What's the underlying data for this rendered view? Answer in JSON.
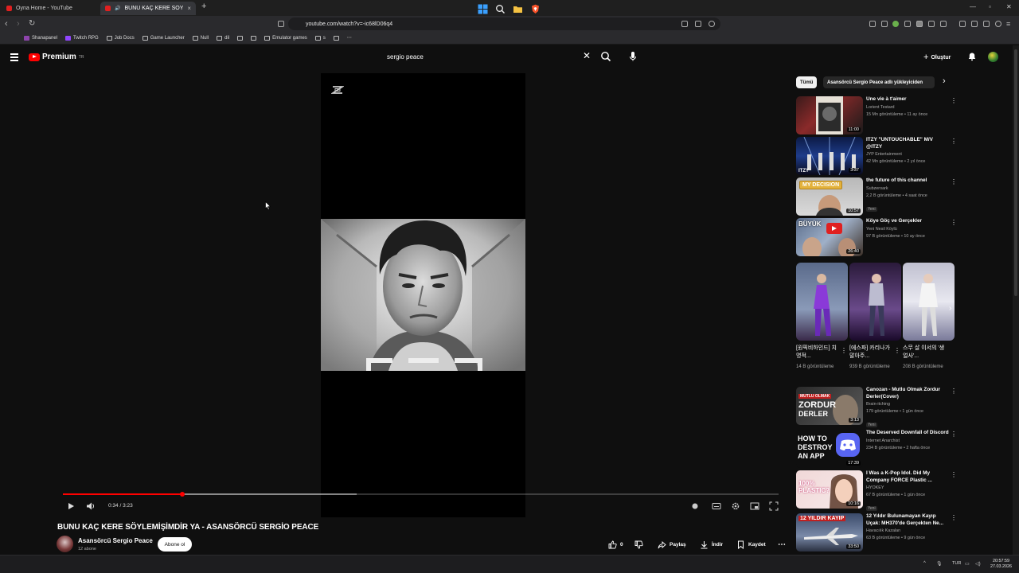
{
  "browser": {
    "tabs": [
      {
        "title": "Oyna Home - YouTube",
        "active": false
      },
      {
        "title": "BUNU KAÇ KERE SÖYLEMİŞİMDİR",
        "active": true
      }
    ],
    "url": "youtube.com/watch?v=-ic68lD06q4",
    "bookmarks": [
      "Shanapanel",
      "Twitch RPG",
      "Job Docs",
      "Game Launcher",
      "Null",
      "dil",
      "",
      "",
      "Emulator games",
      "s"
    ]
  },
  "youtube": {
    "logo_text": "Premium",
    "logo_sup": "TR",
    "search_value": "sergio peace",
    "create_label": "Oluştur"
  },
  "video": {
    "time": "0:34 / 3:23",
    "progress": 0.167,
    "buffered": 0.41,
    "title": "BUNU KAÇ KERE SÖYLEMİŞİMDİR YA - ASANSÖRCÜ SERGİO PEACE",
    "channel": "Asansörcü Sergio Peace",
    "subscribers": "12 abone",
    "subscribe_label": "Abone ol",
    "likes": "0",
    "share_label": "Paylaş",
    "download_label": "İndir",
    "save_label": "Kaydet"
  },
  "sidebar": {
    "chips": [
      "Tümü",
      "Asansörcü Sergio Peace adlı yükleyiciden"
    ],
    "items": [
      {
        "title": "Une vie à t'aimer",
        "channel": "Lorient Testard",
        "meta": "15 Mn görüntüleme • 11 ay önce",
        "duration": "11:00",
        "new": false
      },
      {
        "title": "ITZY \"UNTOUCHABLE\" M/V @ITZY",
        "channel": "JYP Entertainment",
        "meta": "42 Mn görüntüleme • 2 yıl önce",
        "duration": "3:37",
        "new": false
      },
      {
        "title": "the future of this channel",
        "channel": "Subzeroark",
        "meta": "2,2 B görüntüleme • 4 saat önce",
        "duration": "10:57",
        "new": true
      },
      {
        "title": "Köye Göç ve Gerçekler",
        "channel": "Yeni Nesil Köylü",
        "meta": "97 B görüntüleme • 10 ay önce",
        "duration": "26:40",
        "new": false
      }
    ],
    "shorts": [
      {
        "title": "[원픽비하인드] 치명적...",
        "views": "14 B görüntüleme"
      },
      {
        "title": "[에스파] 카리나가 말아주...",
        "views": "939 B görüntüleme"
      },
      {
        "title": "스무 살 이서의 '생얼사'...",
        "views": "208 B görüntüleme"
      }
    ],
    "items2": [
      {
        "title": "Canozan - Mutlu Olmak Zordur Derler(Cover)",
        "channel": "Brain-itching",
        "meta": "179 görüntüleme • 1 gün önce",
        "duration": "3:13",
        "new": true
      },
      {
        "title": "The Deserved Downfall of Discord",
        "channel": "Internet Anarchist",
        "meta": "234 B görüntüleme • 2 hafta önce",
        "duration": "17:39",
        "new": false
      },
      {
        "title": "I Was a K-Pop Idol. Did My Company FORCE Plastic ...",
        "channel": "HYOKEY",
        "meta": "67 B görüntüleme • 1 gün önce",
        "duration": "10:16",
        "new": true
      },
      {
        "title": "12 Yıldır Bulunamayan Kayıp Uçak: MH370'de Gerçekten Ne...",
        "channel": "Havacılık Kazaları",
        "meta": "63 B görüntüleme • 9 gün önce",
        "duration": "33:50",
        "new": false
      }
    ],
    "thumb_text": {
      "decision": "MY DECISION",
      "buyuk": "BÜYÜK",
      "canozan1": "MUTLU OLMAK",
      "canozan2": "ZORDUR",
      "canozan3": "DERLER",
      "howto": "HOW TO DESTROY AN APP",
      "plastic": "100% PLASTIC?",
      "kayip": "12 YILDIR KAYIP",
      "itzy": "ITZY"
    }
  },
  "taskbar": {
    "lang": "TUR",
    "time": "20:57:59",
    "date": "27.03.2026"
  },
  "colors": {
    "accent": "#ff0000",
    "background": "#0f0f0f"
  }
}
